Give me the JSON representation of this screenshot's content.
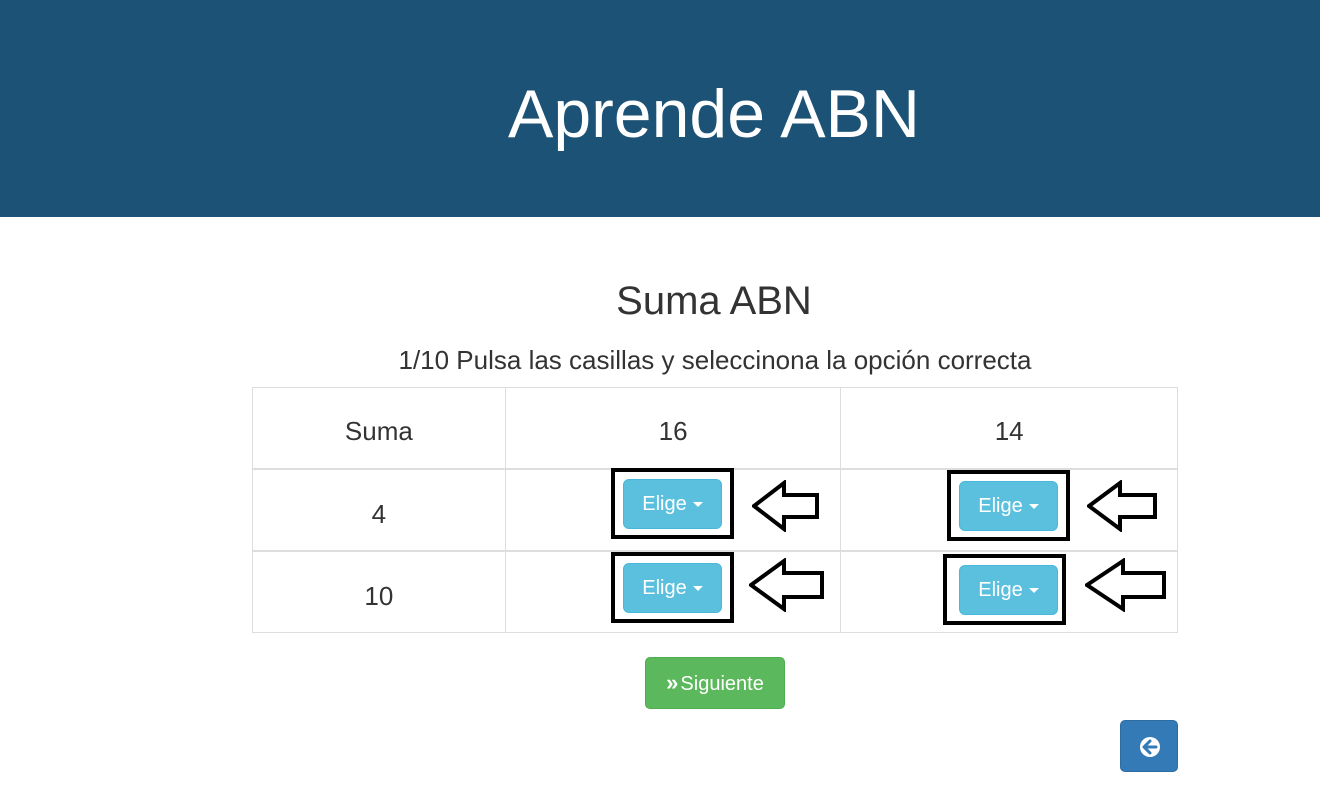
{
  "header": {
    "title": "Aprende ABN"
  },
  "exercise": {
    "title": "Suma ABN",
    "instructions": "1/10 Pulsa las casillas y seleccinona la opción correcta"
  },
  "table": {
    "header": [
      "Suma",
      "16",
      "14"
    ],
    "rows": [
      {
        "label": "4",
        "cells": [
          "Elige",
          "Elige"
        ]
      },
      {
        "label": "10",
        "cells": [
          "Elige",
          "Elige"
        ]
      }
    ]
  },
  "buttons": {
    "next_label": "Siguiente",
    "back_icon": "arrow-circle-left-icon"
  },
  "colors": {
    "banner": "#1c5275",
    "dropdown": "#5bc0de",
    "next": "#5cb85c",
    "back": "#337ab7"
  }
}
